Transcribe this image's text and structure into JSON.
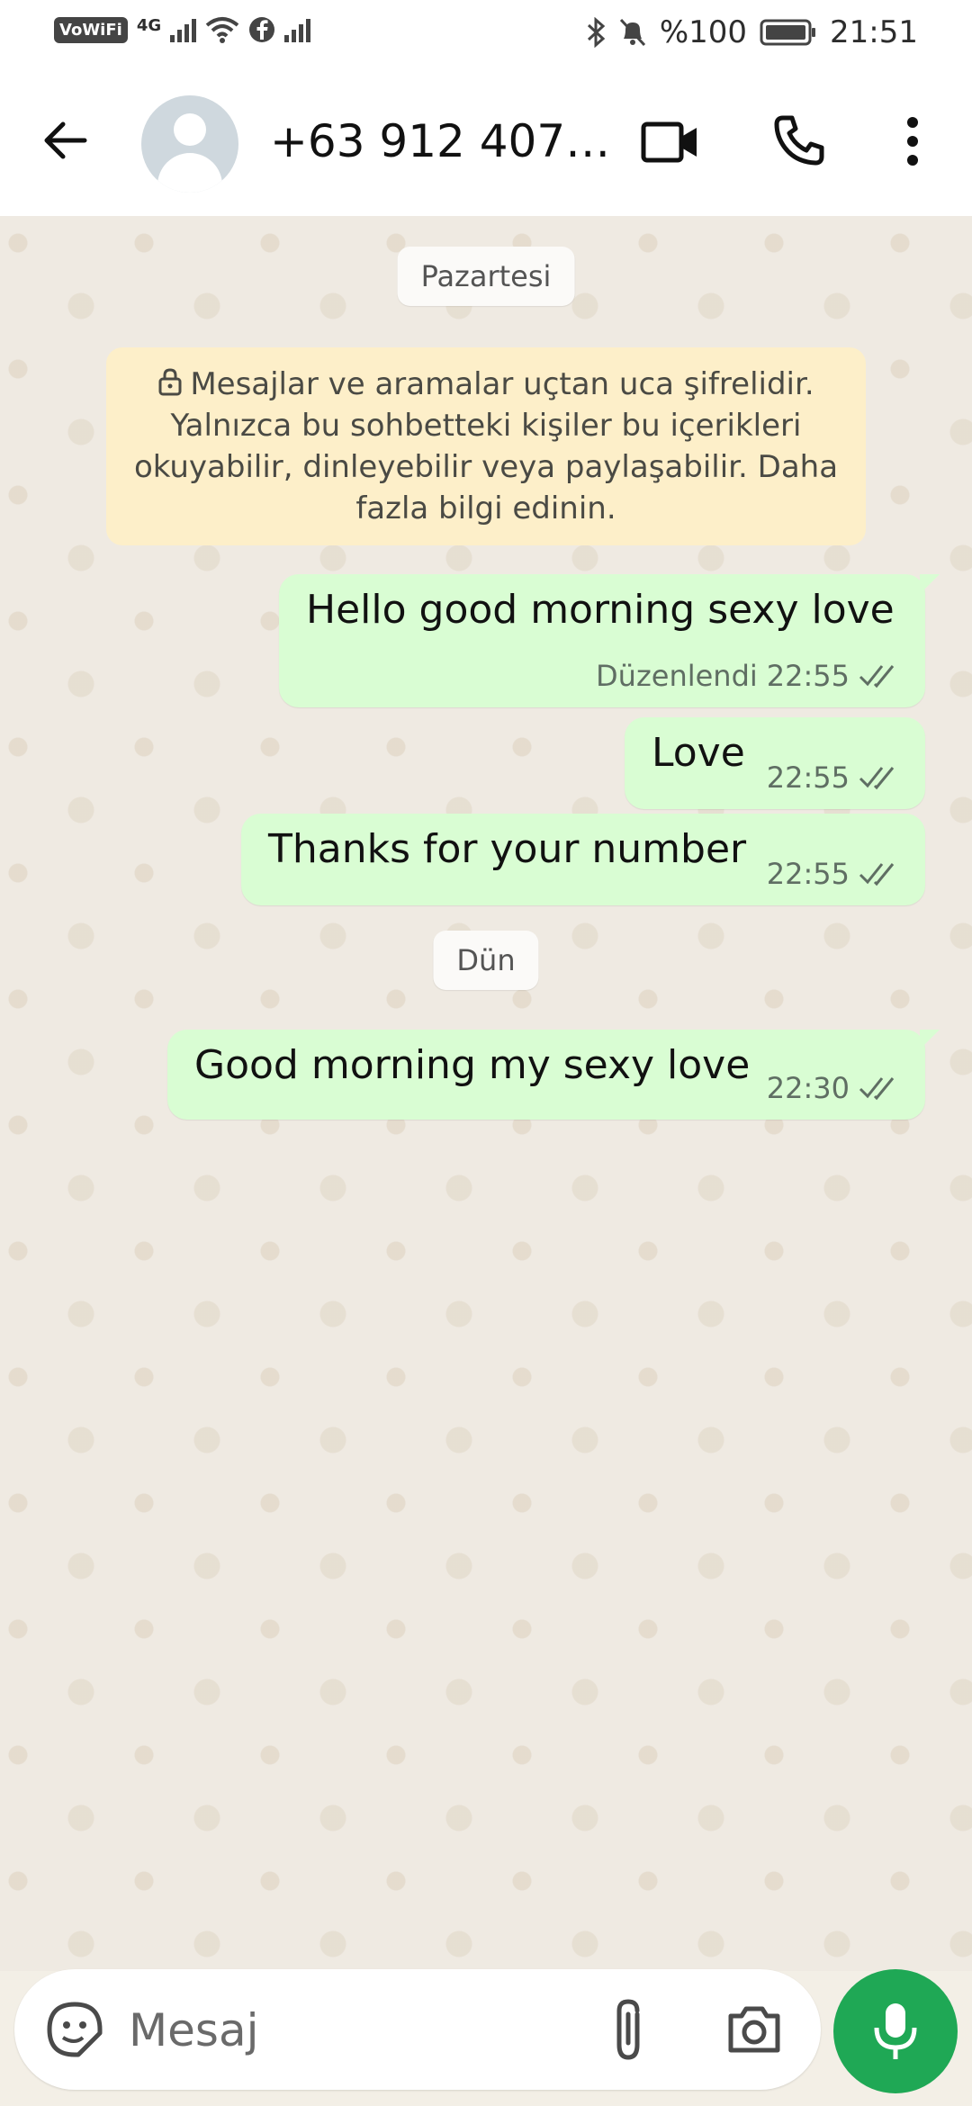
{
  "status_bar": {
    "left_badge": "VoWiFi",
    "network": "4G",
    "battery": "%100",
    "time": "21:51"
  },
  "header": {
    "contact": "+63 912 407…",
    "icons": [
      "back-arrow-icon",
      "avatar-placeholder",
      "video-call-icon",
      "phone-call-icon",
      "more-vert-icon"
    ]
  },
  "chat": {
    "date_1": "Pazartesi",
    "encryption_notice": "Mesajlar ve aramalar uçtan uca şifrelidir. Yalnızca bu sohbetteki kişiler bu içerikleri okuyabilir, dinleyebilir veya paylaşabilir. Daha fazla bilgi edinin.",
    "messages_monday": [
      {
        "text": "Hello good morning sexy love",
        "edited": "Düzenlendi",
        "time": "22:55",
        "status": "read"
      },
      {
        "text": "Love",
        "time": "22:55",
        "status": "read"
      },
      {
        "text": "Thanks for your number",
        "time": "22:55",
        "status": "read"
      }
    ],
    "date_2": "Dün",
    "messages_yesterday": [
      {
        "text": "Good morning my sexy love",
        "time": "22:30",
        "status": "read"
      }
    ]
  },
  "composer": {
    "placeholder": "Mesaj",
    "icons": [
      "sticker-icon",
      "attach-icon",
      "camera-icon",
      "mic-icon"
    ]
  },
  "colors": {
    "outgoing_bubble": "#d9fdd3",
    "notice_bg": "#fdefc9",
    "mic_button": "#1fa855",
    "chat_bg": "#efeae2"
  }
}
